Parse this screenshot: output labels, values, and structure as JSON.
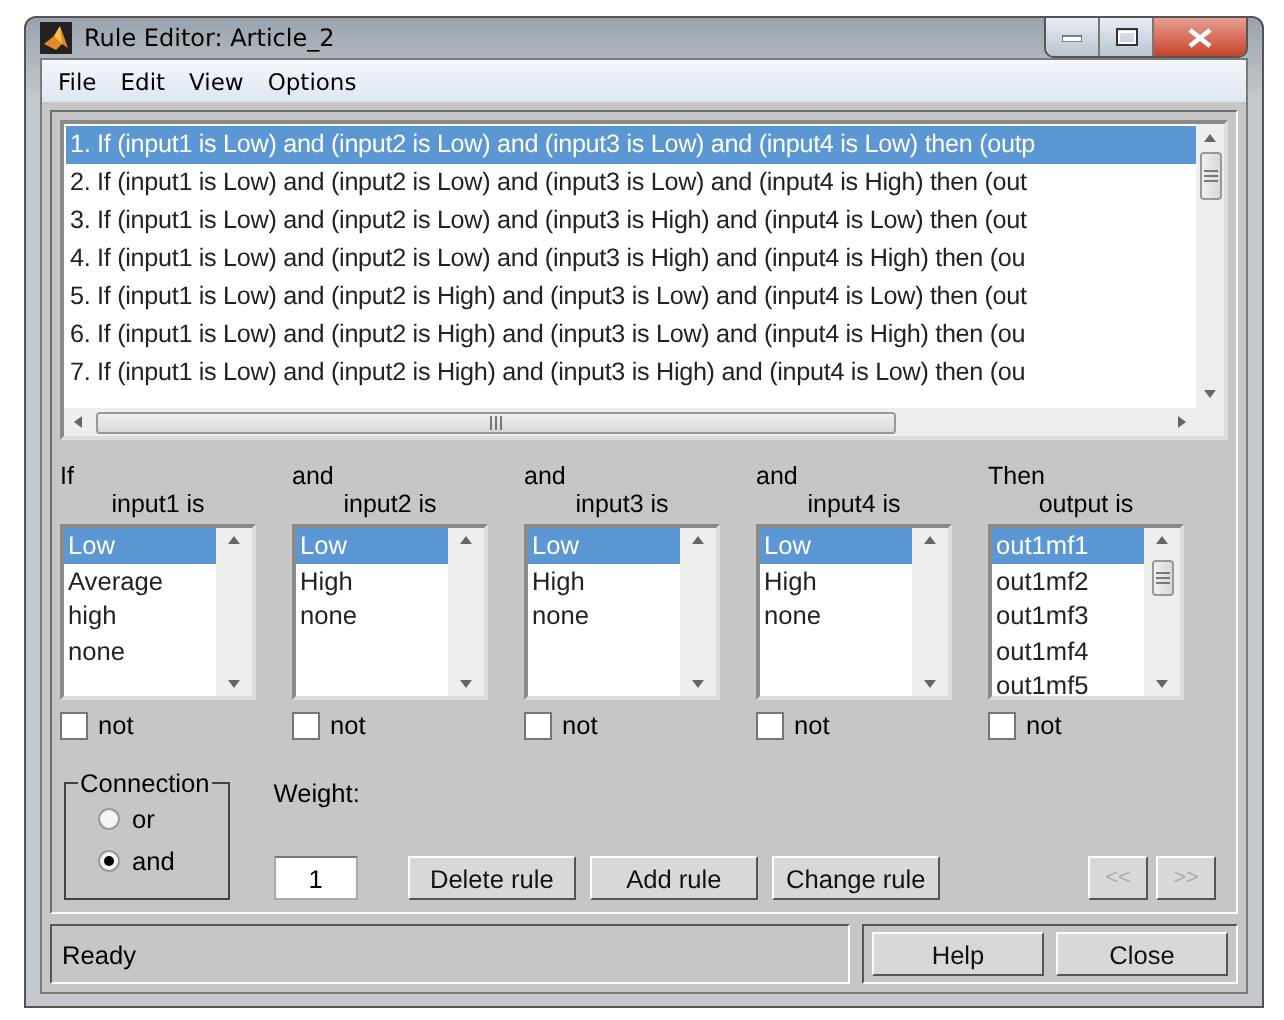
{
  "window": {
    "title": "Rule Editor: Article_2"
  },
  "menu": [
    "File",
    "Edit",
    "View",
    "Options"
  ],
  "rules": [
    {
      "text": "1. If (input1 is Low) and (input2 is Low) and (input3 is Low) and (input4 is Low) then (outp",
      "selected": true
    },
    {
      "text": "2. If (input1 is Low) and (input2 is Low) and (input3 is Low) and (input4 is High) then (out",
      "selected": false
    },
    {
      "text": "3. If (input1 is Low) and (input2 is Low) and (input3 is High) and (input4 is Low) then (out",
      "selected": false
    },
    {
      "text": "4. If (input1 is Low) and (input2 is Low) and (input3 is High) and (input4 is High) then (ou",
      "selected": false
    },
    {
      "text": "5. If (input1 is Low) and (input2 is High) and (input3 is Low) and (input4 is Low) then (out",
      "selected": false
    },
    {
      "text": "6. If (input1 is Low) and (input2 is High) and (input3 is Low) and (input4 is High) then (ou",
      "selected": false
    },
    {
      "text": "7. If (input1 is Low) and (input2 is High) and (input3 is High) and (input4 is Low) then (ou",
      "selected": false
    }
  ],
  "columns": [
    {
      "connector": "If",
      "label": "input1 is",
      "not_label": "not",
      "not_checked": false,
      "items": [
        {
          "label": "Low",
          "selected": true
        },
        {
          "label": "Average",
          "selected": false
        },
        {
          "label": "high",
          "selected": false
        },
        {
          "label": "none",
          "selected": false
        }
      ]
    },
    {
      "connector": "and",
      "label": "input2 is",
      "not_label": "not",
      "not_checked": false,
      "items": [
        {
          "label": "Low",
          "selected": true
        },
        {
          "label": "High",
          "selected": false
        },
        {
          "label": "none",
          "selected": false
        }
      ]
    },
    {
      "connector": "and",
      "label": "input3 is",
      "not_label": "not",
      "not_checked": false,
      "items": [
        {
          "label": "Low",
          "selected": true
        },
        {
          "label": "High",
          "selected": false
        },
        {
          "label": "none",
          "selected": false
        }
      ]
    },
    {
      "connector": "and",
      "label": "input4 is",
      "not_label": "not",
      "not_checked": false,
      "items": [
        {
          "label": "Low",
          "selected": true
        },
        {
          "label": "High",
          "selected": false
        },
        {
          "label": "none",
          "selected": false
        }
      ]
    },
    {
      "connector": "Then",
      "label": "output is",
      "not_label": "not",
      "not_checked": false,
      "items": [
        {
          "label": "out1mf1",
          "selected": true
        },
        {
          "label": "out1mf2",
          "selected": false
        },
        {
          "label": "out1mf3",
          "selected": false
        },
        {
          "label": "out1mf4",
          "selected": false
        },
        {
          "label": "out1mf5",
          "selected": false
        }
      ]
    }
  ],
  "connection": {
    "title": "Connection",
    "options": [
      {
        "label": "or",
        "selected": false
      },
      {
        "label": "and",
        "selected": true
      }
    ]
  },
  "weight": {
    "label": "Weight:",
    "value": "1"
  },
  "buttons": [
    {
      "label": "Delete rule",
      "disabled": false
    },
    {
      "label": "Add rule",
      "disabled": false
    },
    {
      "label": "Change rule",
      "disabled": false
    }
  ],
  "nav_buttons": [
    {
      "label": "<<",
      "disabled": true
    },
    {
      "label": ">>",
      "disabled": true
    }
  ],
  "status": "Ready",
  "footer_buttons": [
    "Help",
    "Close"
  ]
}
